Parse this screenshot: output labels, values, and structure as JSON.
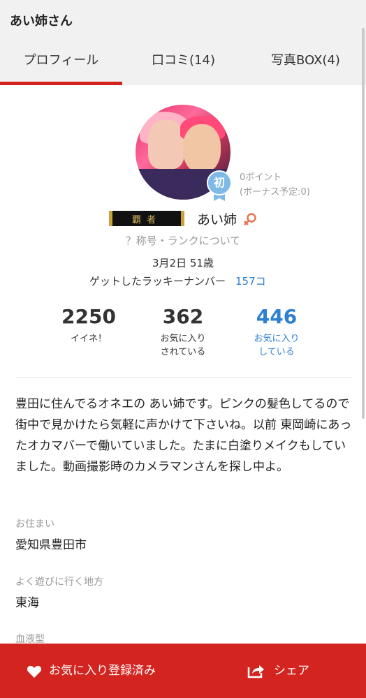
{
  "header": {
    "title": "あい姉さん"
  },
  "tabs": [
    {
      "label": "プロフィール",
      "active": true
    },
    {
      "label": "口コミ(14)",
      "active": false
    },
    {
      "label": "写真BOX(4)",
      "active": false
    }
  ],
  "profile": {
    "badge_char": "初",
    "points": "0ポイント",
    "bonus": "(ボーナス予定:0)",
    "rank_plate_text": "覇者",
    "name": "あい姉",
    "gender_icon": "female-icon",
    "rank_link": "？称号・ランクについて",
    "birth_age": "3月2日 51歳",
    "lucky_label": "ゲットしたラッキーナンバー",
    "lucky_count": "157コ"
  },
  "stats": [
    {
      "value": "2250",
      "label1": "イイネ！",
      "label2": ""
    },
    {
      "value": "362",
      "label1": "お気に入り",
      "label2": "されている"
    },
    {
      "value": "446",
      "label1": "お気に入り",
      "label2": "している"
    }
  ],
  "bio": "豊田に住んでるオネエの あい姉です。ピンクの髪色してるので街中で見かけたら気軽に声かけて下さいね。以前 東岡崎にあったオカマバーで働いていました。たまに白塗りメイクもしていました。動画撮影時のカメラマンさんを探し中よ。",
  "fields": {
    "residence_label": "お住まい",
    "residence_value": "愛知県豊田市",
    "area_label": "よく遊びに行く地方",
    "area_value": "東海",
    "blood_label": "血液型"
  },
  "bottom_bar": {
    "favorite_label": "お気に入り登録済み",
    "share_label": "シェア"
  },
  "colors": {
    "accent_red": "#d32420",
    "link_blue": "#2d7fd1"
  }
}
